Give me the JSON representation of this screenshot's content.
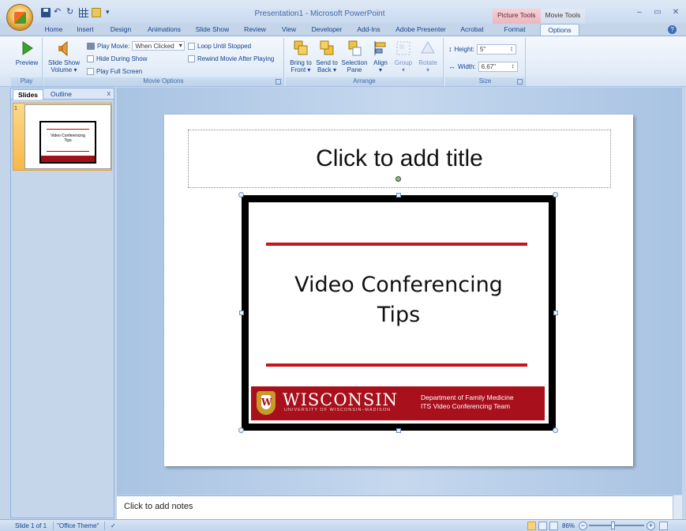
{
  "window": {
    "title": "Presentation1 - Microsoft PowerPoint",
    "context_tools": [
      "Picture Tools",
      "Movie Tools"
    ],
    "controls": [
      "minimize-icon",
      "restore-icon",
      "close-icon"
    ]
  },
  "tabs": [
    "Home",
    "Insert",
    "Design",
    "Animations",
    "Slide Show",
    "Review",
    "View",
    "Developer",
    "Add-Ins",
    "Adobe Presenter",
    "Acrobat",
    "Format",
    "Options"
  ],
  "active_tab": "Options",
  "ribbon": {
    "play": {
      "label": "Play",
      "preview": "Preview"
    },
    "movie_options": {
      "label": "Movie Options",
      "slide_show_volume": [
        "Slide Show",
        "Volume"
      ],
      "play_movie_label": "Play Movie:",
      "play_movie_value": "When Clicked",
      "hide_during_show": "Hide During Show",
      "play_full_screen": "Play Full Screen",
      "loop_until_stopped": "Loop Until Stopped",
      "rewind_movie": "Rewind Movie After Playing"
    },
    "arrange": {
      "label": "Arrange",
      "bring_to_front": [
        "Bring to",
        "Front"
      ],
      "send_to_back": [
        "Send to",
        "Back"
      ],
      "selection_pane": [
        "Selection",
        "Pane"
      ],
      "align": "Align",
      "group": "Group",
      "rotate": "Rotate"
    },
    "size": {
      "label": "Size",
      "height_label": "Height:",
      "height_value": "5\"",
      "width_label": "Width:",
      "width_value": "6.67\""
    }
  },
  "slides_pane": {
    "tabs": [
      "Slides",
      "Outline"
    ],
    "close": "x",
    "thumb_number": "1",
    "thumb_title": [
      "Video Conferencing",
      "Tips"
    ]
  },
  "slide": {
    "title_placeholder": "Click to add title",
    "video": {
      "title_lines": [
        "Video Conferencing",
        "Tips"
      ],
      "university": "WISCONSIN",
      "university_sub": "UNIVERSITY OF WISCONSIN–MADISON",
      "dept_lines": [
        "Department of Family Medicine",
        "ITS Video Conferencing Team"
      ]
    }
  },
  "notes_placeholder": "Click to add notes",
  "status": {
    "slide_of": "Slide 1 of 1",
    "theme": "\"Office Theme\"",
    "zoom": "86%"
  },
  "colors": {
    "accent_red": "#c8141c",
    "banner_red": "#a8101c",
    "ribbon_text": "#15428b"
  }
}
